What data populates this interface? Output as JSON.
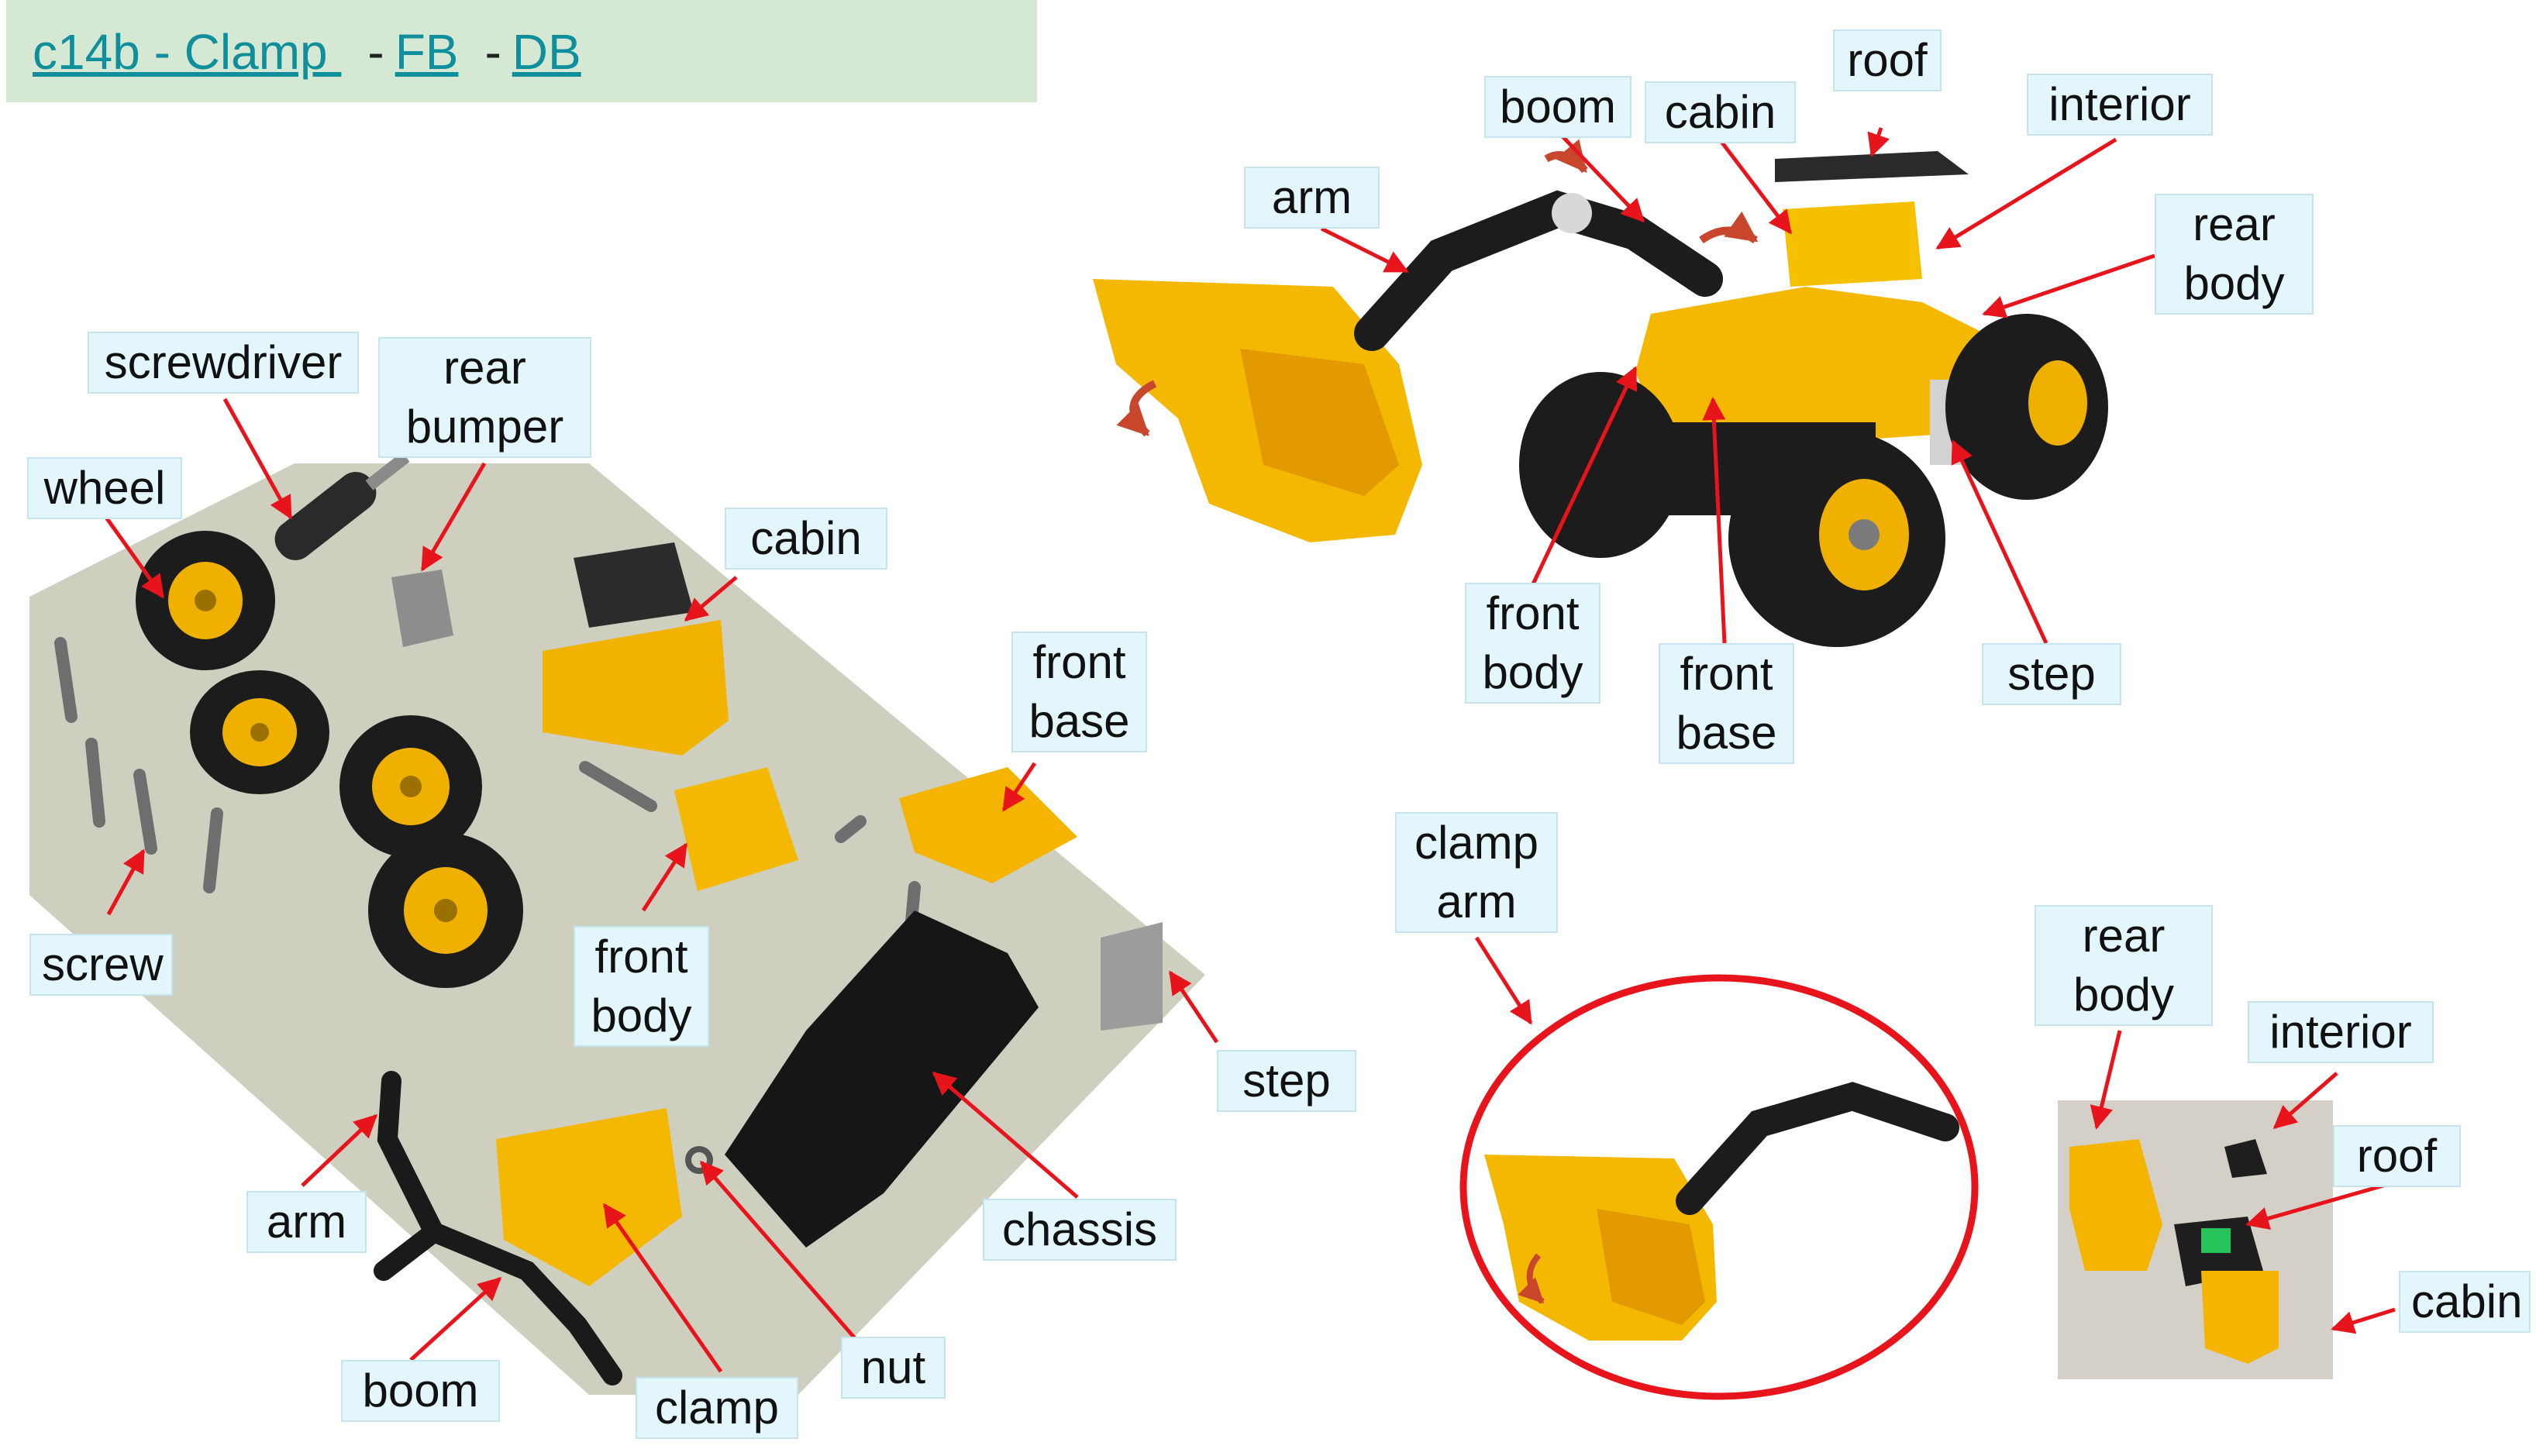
{
  "header": {
    "title_link": "c14b - Clamp ",
    "separator": "-",
    "fb_link": "FB",
    "db_link": "DB"
  },
  "labels": {
    "screwdriver": "screwdriver",
    "rear_bumper_line1": "rear",
    "rear_bumper_line2": "bumper",
    "wheel": "wheel",
    "cabin_left": "cabin",
    "front_base_left_line1": "front",
    "front_base_left_line2": "base",
    "screw": "screw",
    "front_body_left_line1": "front",
    "front_body_left_line2": "body",
    "step_left": "step",
    "arm_left": "arm",
    "chassis": "chassis",
    "boom_left": "boom",
    "clamp": "clamp",
    "nut": "nut",
    "boom_top": "boom",
    "cabin_top": "cabin",
    "roof_top": "roof",
    "interior_top": "interior",
    "arm_top": "arm",
    "rear_body_top_line1": "rear",
    "rear_body_top_line2": "body",
    "front_body_top_line1": "front",
    "front_body_top_line2": "body",
    "front_base_top_line1": "front",
    "front_base_top_line2": "base",
    "step_top": "step",
    "clamp_arm_line1": "clamp",
    "clamp_arm_line2": "arm",
    "rear_body_small_line1": "rear",
    "rear_body_small_line2": "body",
    "interior_small": "interior",
    "roof_small": "roof",
    "cabin_small": "cabin"
  },
  "colors": {
    "header_bg": "#d5e8d4",
    "link": "#0f8f9b",
    "label_bg": "#e2f6fb",
    "arrow": "#e8141c",
    "part_yellow": "#f5b400",
    "part_black": "#1c1c1c"
  }
}
